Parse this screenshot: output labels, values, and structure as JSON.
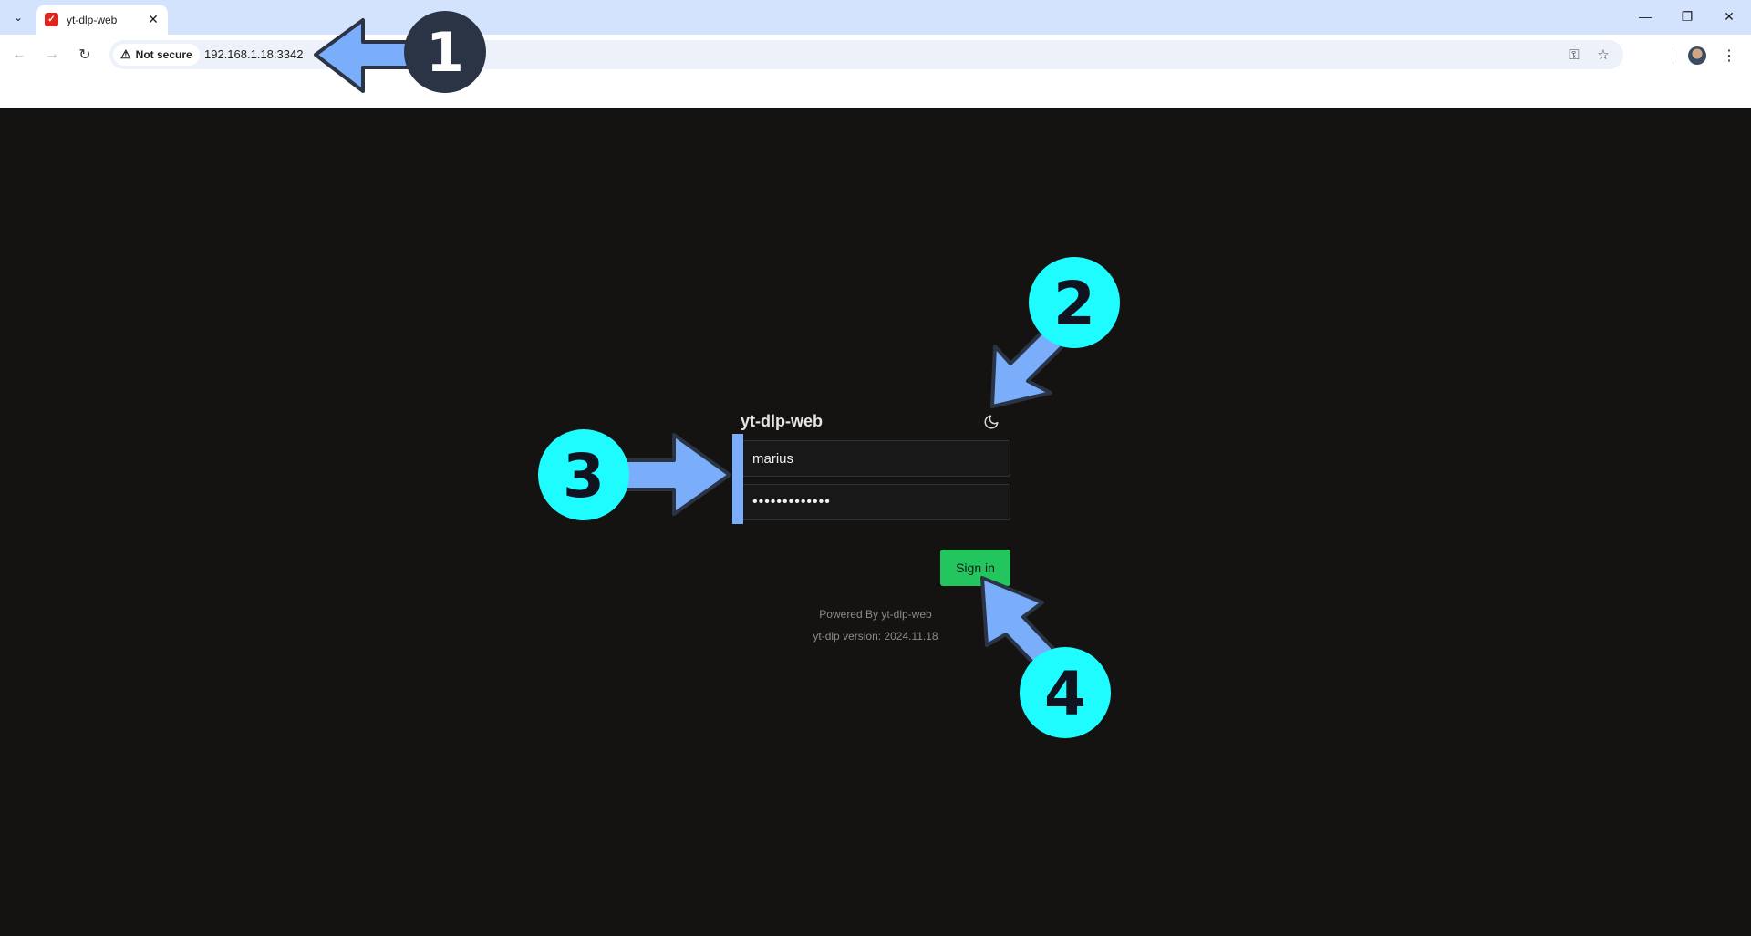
{
  "browser": {
    "tab_title": "yt-dlp-web",
    "security_label": "Not secure",
    "url": "192.168.1.18:3342"
  },
  "login": {
    "app_title": "yt-dlp-web",
    "username_value": "marius",
    "password_value": "•••••••••••••",
    "signin_label": "Sign in",
    "powered_by": "Powered By yt-dlp-web",
    "version": "yt-dlp version: 2024.11.18"
  },
  "annotations": {
    "step_1": "1",
    "step_2": "2",
    "step_3": "3",
    "step_4": "4",
    "dark_badge_color": "#2b3445",
    "cyan_badge_color": "#1ffcff",
    "arrow_color": "#7aaefa"
  }
}
